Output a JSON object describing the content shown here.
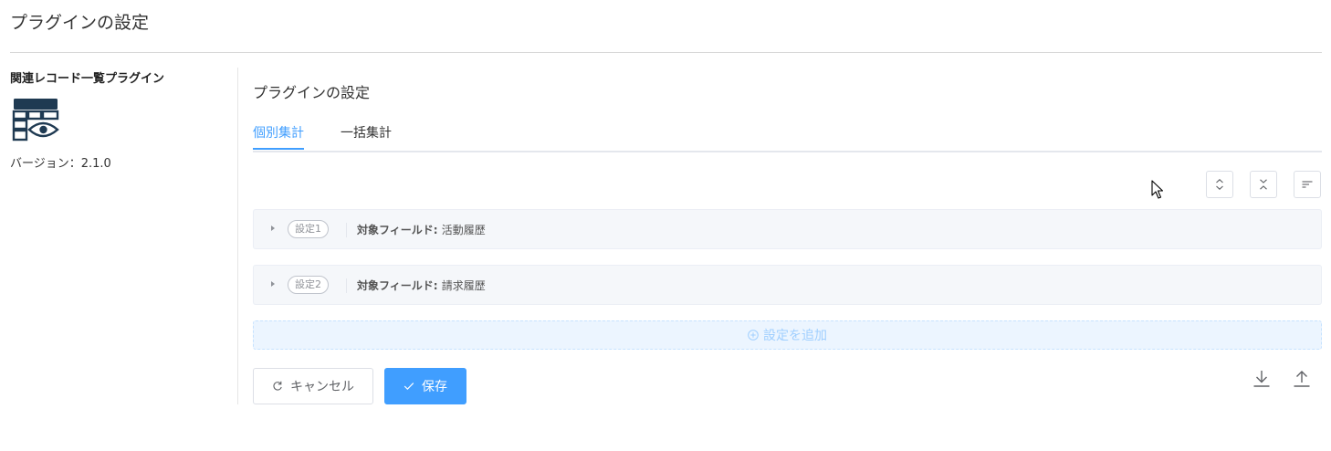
{
  "page": {
    "title": "プラグインの設定"
  },
  "sidebar": {
    "plugin_name": "関連レコード一覧プラグイン",
    "version": "バージョン：2.1.0",
    "icon": "table-eye-icon"
  },
  "main": {
    "section_title": "プラグインの設定",
    "tabs": [
      {
        "label": "個別集計",
        "active": true
      },
      {
        "label": "一括集計",
        "active": false
      }
    ],
    "toolbar": {
      "icons": [
        "expand-all-icon",
        "collapse-all-icon",
        "sort-icon"
      ]
    },
    "settings": [
      {
        "tag": "設定1",
        "field_label": "対象フィールド:",
        "field_value": "活動履歴"
      },
      {
        "tag": "設定2",
        "field_label": "対象フィールド:",
        "field_value": "請求履歴"
      }
    ],
    "add_setting_label": "設定を追加",
    "buttons": {
      "cancel": "キャンセル",
      "save": "保存"
    },
    "io_icons": [
      "download-icon",
      "upload-icon"
    ]
  },
  "colors": {
    "primary": "#409eff",
    "icon_dark": "#1f3a52",
    "add_bg": "#ecf5ff"
  }
}
